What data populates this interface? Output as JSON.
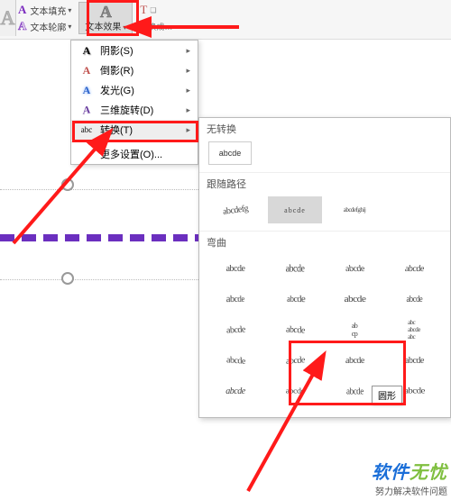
{
  "toolbar": {
    "fill_label": "文本填充",
    "outline_label": "文本轮廓",
    "effects_label": "文本效果",
    "other_label": "转换成…"
  },
  "menu": {
    "shadow": "阴影(S)",
    "reflection": "倒影(R)",
    "glow": "发光(G)",
    "rotation3d": "三维旋转(D)",
    "transform": "转换(T)",
    "more": "更多设置(O)..."
  },
  "transform": {
    "no_transform": "无转换",
    "none_sample": "abcde",
    "follow_path": "跟随路径",
    "warp": "弯曲",
    "sample": "abcde",
    "path_samples": [
      "abcdefg",
      "abcde",
      "abcdefghij"
    ],
    "tooltip": "圆形"
  },
  "watermark": {
    "brand": "软件无忧",
    "slogan": "努力解决软件问题"
  }
}
